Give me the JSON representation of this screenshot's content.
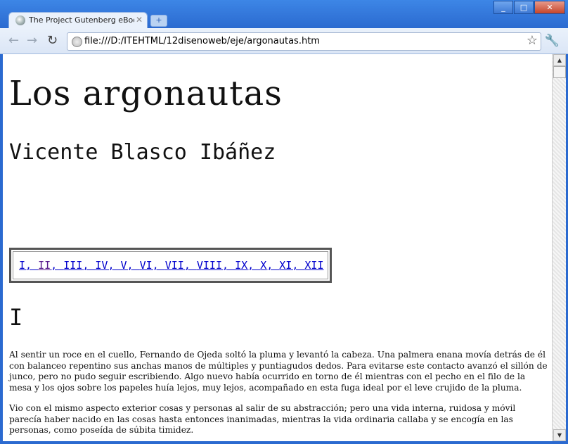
{
  "browser": {
    "tab_title": "The Project Gutenberg eBook o",
    "new_tab": "+",
    "url": "file:///D:/ITEHTML/12disenoweb/eje/argonautas.htm",
    "window_buttons": [
      "_",
      "□",
      "✕"
    ]
  },
  "page": {
    "title": "Los argonautas",
    "author": "Vicente Blasco Ibáñez",
    "toc": [
      "I",
      "II",
      "III",
      "IV",
      "V",
      "VI",
      "VII",
      "VIII",
      "IX",
      "X",
      "XI",
      "XII"
    ],
    "chapter_heading": "I",
    "paragraphs": [
      "Al sentir un roce en el cuello, Fernando de Ojeda soltó la pluma y levantó la cabeza. Una palmera enana movía detrás de él con balanceo repentino sus anchas manos de múltiples y puntiagudos dedos. Para evitarse este contacto avanzó el sillón de junco, pero no pudo seguir escribiendo. Algo nuevo había ocurrido en torno de él mientras con el pecho en el filo de la mesa y los ojos sobre los papeles huía lejos, muy lejos, acompañado en esta fuga ideal por el leve crujido de la pluma.",
      "Vio con el mismo aspecto exterior cosas y personas al salir de su abstracción; pero una vida interna, ruidosa y móvil parecía haber nacido en las cosas hasta entonces inanimadas, mientras la vida ordinaria callaba y se encogía en las personas, como poseída de súbita timidez."
    ]
  }
}
